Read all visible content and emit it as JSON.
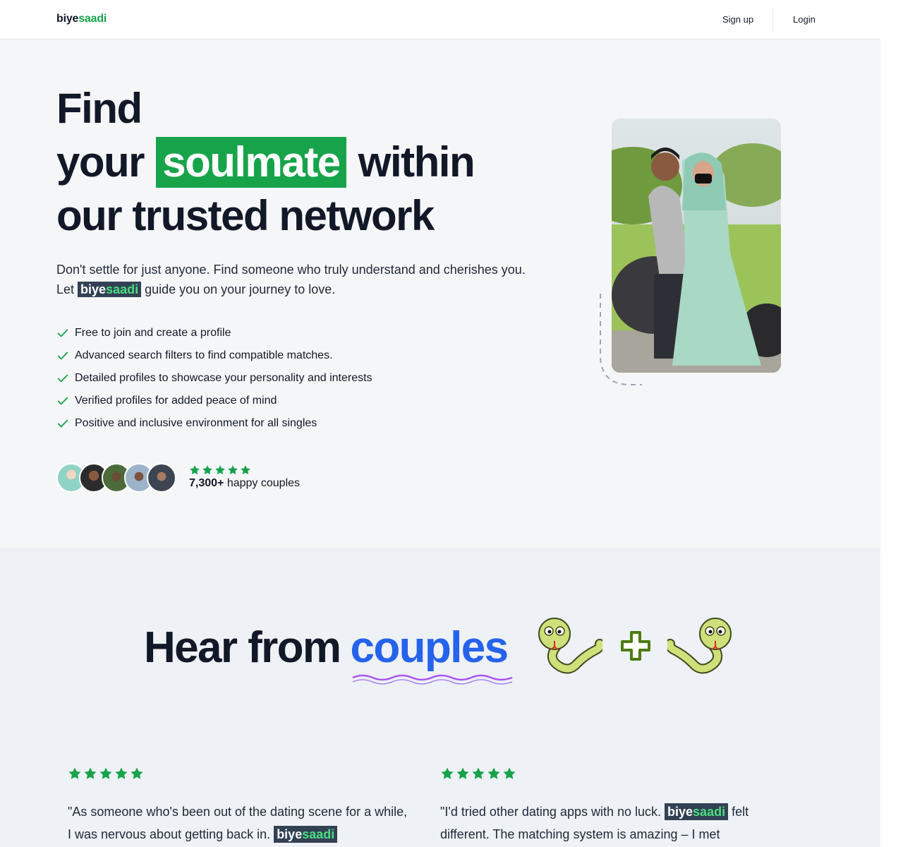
{
  "nav": {
    "logo_part1": "biye",
    "logo_part2": "saadi",
    "signup_label": "Sign up",
    "login_label": "Login"
  },
  "hero": {
    "headline_line1": "Find",
    "headline_your": "your",
    "headline_highlight": "soulmate",
    "headline_within": "within",
    "headline_line3": "our trusted network",
    "lead_before": "Don't settle for just anyone. Find someone who truly understand and cherishes you. Let ",
    "brand_part1": "biye",
    "brand_part2": "saadi",
    "lead_after": " guide you on your journey to love.",
    "features": [
      "Free to join and create a profile",
      "Advanced search filters to find compatible matches.",
      "Detailed profiles to showcase your personality and interests",
      "Verified profiles for added peace of mind",
      "Positive and inclusive environment for all singles"
    ],
    "rating_stars": 5,
    "couples_count": "7,300+",
    "couples_label": " happy couples"
  },
  "testimonials": {
    "heading_part1": "Hear from",
    "heading_part2": "couples",
    "reviews": [
      {
        "stars": 5,
        "text_before": "\"As someone who's been out of the dating scene for a while, I was nervous about getting back in. ",
        "brand_part1": "biye",
        "brand_part2": "saadi"
      },
      {
        "stars": 5,
        "text_before": "\"I'd tried other dating apps with no luck. ",
        "brand_part1": "biye",
        "brand_part2": "saadi",
        "text_after": " felt different. The matching system is amazing – I met"
      }
    ]
  },
  "colors": {
    "brand_green": "#16a34a",
    "heading_blue": "#2563eb",
    "text_dark": "#111827",
    "chip_bg": "#334155"
  },
  "icons": {
    "check": "check-icon",
    "star": "star-icon",
    "plus": "plus-icon",
    "snake": "snake-emoji"
  }
}
